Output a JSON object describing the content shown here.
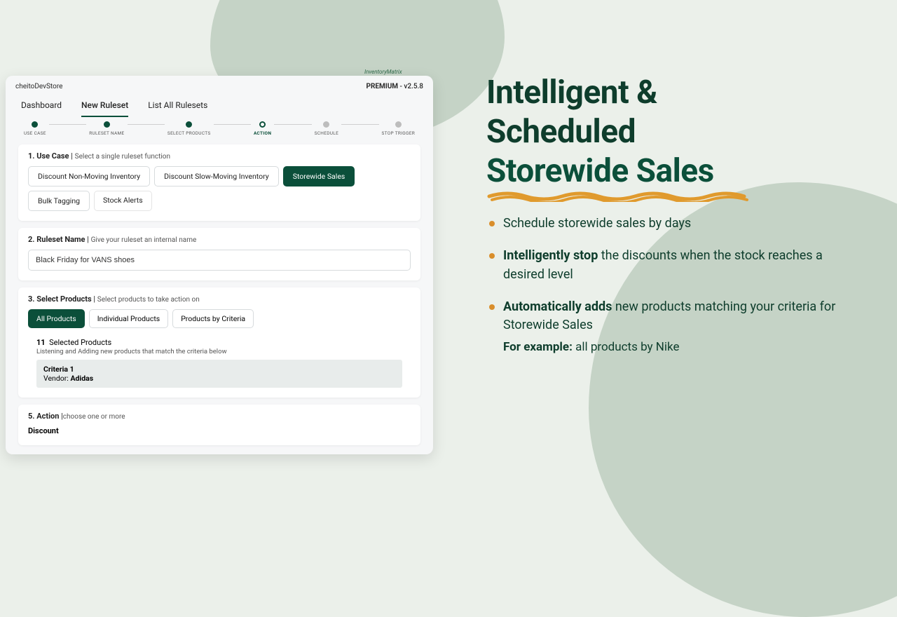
{
  "brandmark": "InventoryMatrix",
  "app": {
    "store_name": "cheitoDevStore",
    "plan_label": "PREMIUM",
    "version": "v2.5.8",
    "tabs": [
      "Dashboard",
      "New Ruleset",
      "List All Rulesets"
    ],
    "active_tab_index": 1,
    "stepper": [
      {
        "label": "USE CASE",
        "state": "done"
      },
      {
        "label": "RULESET NAME",
        "state": "done"
      },
      {
        "label": "SELECT PRODUCTS",
        "state": "done"
      },
      {
        "label": "ACTION",
        "state": "current"
      },
      {
        "label": "SCHEDULE",
        "state": "pending"
      },
      {
        "label": "STOP TRIGGER",
        "state": "pending"
      }
    ],
    "usecase": {
      "title_num": "1. Use Case",
      "hint": "Select a single ruleset function",
      "options": [
        "Discount Non-Moving Inventory",
        "Discount Slow-Moving Inventory",
        "Storewide Sales",
        "Bulk Tagging",
        "Stock Alerts"
      ],
      "active_index": 2
    },
    "name": {
      "title_num": "2. Ruleset Name",
      "hint": "Give your ruleset an internal name",
      "value": "Black Friday for VANS shoes"
    },
    "select": {
      "title_num": "3. Select Products",
      "hint": "Select products to take action on",
      "scopes": [
        "All Products",
        "Individual Products",
        "Products by Criteria"
      ],
      "active_scope": 0,
      "count": 11,
      "count_label": "Selected Products",
      "listening_text": "Listening and Adding new products that match the criteria below",
      "criteria": {
        "label": "Criteria 1",
        "key": "Vendor:",
        "value": "Adidas"
      }
    },
    "action": {
      "title_num": "5. Action",
      "hint": "choose one or more",
      "primary": "Discount"
    }
  },
  "promo": {
    "headline_a": "Intelligent &",
    "headline_b": "Scheduled",
    "headline_c": "Storewide Sales",
    "bullets": [
      {
        "text_a": "Schedule storewide sales by days"
      },
      {
        "bold": "Intelligently stop",
        "text_a": " the discounts when the stock reaches a desired level"
      },
      {
        "bold": "Automatically adds",
        "text_a": " new products matching your criteria for Storewide Sales"
      }
    ],
    "example_label": "For example:",
    "example_text": " all products by Nike"
  }
}
